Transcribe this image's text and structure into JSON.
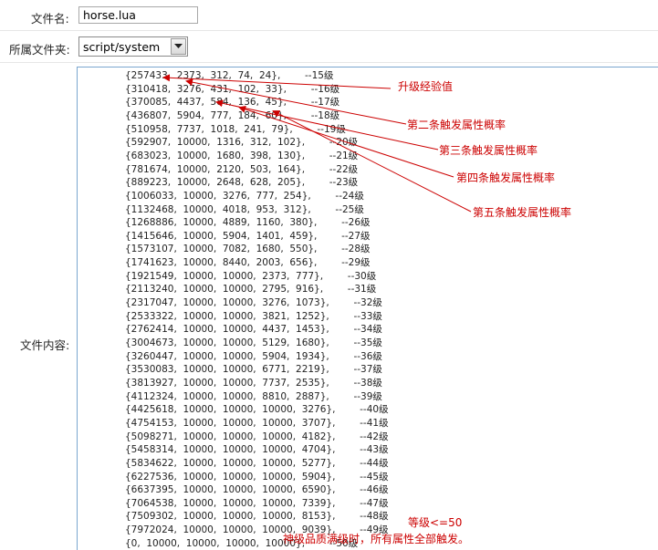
{
  "form": {
    "filename_label": "文件名:",
    "filename_value": "horse.lua",
    "folder_label": "所属文件夹:",
    "folder_value": "script/system",
    "content_label": "文件内容:"
  },
  "code_lines": [
    "{257433,  2373,  312,  74,  24},        --15级",
    "{310418,  3276,  431,  102,  33},        --16级",
    "{370085,  4437,  584,  136,  45},        --17级",
    "{436807,  5904,  777,  184,  60},        --18级",
    "{510958,  7737,  1018,  241,  79},        --19级",
    "{592907,  10000,  1316,  312,  102},        --20级",
    "{683023,  10000,  1680,  398,  130},        --21级",
    "{781674,  10000,  2120,  503,  164},        --22级",
    "{889223,  10000,  2648,  628,  205},        --23级",
    "{1006033,  10000,  3276,  777,  254},        --24级",
    "{1132468,  10000,  4018,  953,  312},        --25级",
    "{1268886,  10000,  4889,  1160,  380},        --26级",
    "{1415646,  10000,  5904,  1401,  459},        --27级",
    "{1573107,  10000,  7082,  1680,  550},        --28级",
    "{1741623,  10000,  8440,  2003,  656},        --29级",
    "{1921549,  10000,  10000,  2373,  777},        --30级",
    "{2113240,  10000,  10000,  2795,  916},        --31级",
    "{2317047,  10000,  10000,  3276,  1073},        --32级",
    "{2533322,  10000,  10000,  3821,  1252},        --33级",
    "{2762414,  10000,  10000,  4437,  1453},        --34级",
    "{3004673,  10000,  10000,  5129,  1680},        --35级",
    "{3260447,  10000,  10000,  5904,  1934},        --36级",
    "{3530083,  10000,  10000,  6771,  2219},        --37级",
    "{3813927,  10000,  10000,  7737,  2535},        --38级",
    "{4112324,  10000,  10000,  8810,  2887},        --39级",
    "{4425618,  10000,  10000,  10000,  3276},        --40级",
    "{4754153,  10000,  10000,  10000,  3707},        --41级",
    "{5098271,  10000,  10000,  10000,  4182},        --42级",
    "{5458314,  10000,  10000,  10000,  4704},        --43级",
    "{5834622,  10000,  10000,  10000,  5277},        --44级",
    "{6227536,  10000,  10000,  10000,  5904},        --45级",
    "{6637395,  10000,  10000,  10000,  6590},        --46级",
    "{7064538,  10000,  10000,  10000,  7339},        --47级",
    "{7509302,  10000,  10000,  10000,  8153},        --48级",
    "{7972024,  10000,  10000,  10000,  9039},        --49级",
    "{0,  10000,  10000,  10000,  10000},        --50级"
  ],
  "code_tail": [
    "},",
    "}"
  ],
  "annotations": {
    "exp": "升级经验值",
    "prob2": "第二条触发属性概率",
    "prob3": "第三条触发属性概率",
    "prob4": "第四条触发属性概率",
    "prob5": "第五条触发属性概率",
    "level_cap": "等级<=50",
    "max_note": "神级品质满级时，所有属性全部触发。"
  },
  "colors": {
    "annotation": "#cc0000",
    "textarea_border": "#7aa6cf"
  },
  "icons": {
    "select_arrow": "chevron-down-icon"
  }
}
